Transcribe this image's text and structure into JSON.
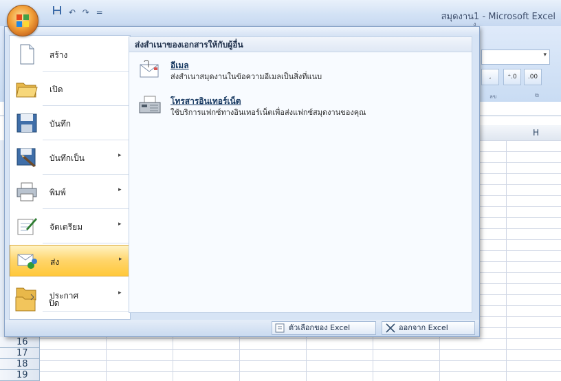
{
  "window": {
    "title": "สมุดงาน1 - Microsoft Excel"
  },
  "quick_access": {
    "save_icon": "save-icon",
    "undo": "↶",
    "redo": "↷",
    "customize": "="
  },
  "ribbon": {
    "tab_hint": "ง",
    "combo_arrow": "▾",
    "btn_increase": "+.0\n.00",
    "btn_decrease": ".00\n→.0",
    "group_label": "ลข",
    "comma": ","
  },
  "column_header_H": "H",
  "rows": [
    "16",
    "17",
    "18",
    "19"
  ],
  "menu": {
    "items": [
      {
        "label": "สร้าง",
        "icon": "new-document-icon",
        "arrow": ""
      },
      {
        "label": "เปิด",
        "icon": "open-folder-icon",
        "arrow": ""
      },
      {
        "label": "บันทึก",
        "icon": "save-icon",
        "arrow": ""
      },
      {
        "label": "บันทึกเป็น",
        "icon": "save-as-icon",
        "arrow": "▸"
      },
      {
        "label": "พิมพ์",
        "icon": "printer-icon",
        "arrow": "▸"
      },
      {
        "label": "จัดเตรียม",
        "icon": "prepare-icon",
        "arrow": "▸"
      },
      {
        "label": "ส่ง",
        "icon": "send-icon",
        "arrow": "▸"
      },
      {
        "label": "ประกาศ",
        "icon": "publish-icon",
        "arrow": "▸"
      },
      {
        "label": "ปิด",
        "icon": "close-folder-icon",
        "arrow": ""
      }
    ],
    "submenu_title": "ส่งสำเนาของเอกสารให้กับผู้อื่น",
    "submenu": [
      {
        "title": "อีเมล",
        "desc": "ส่งสำเนาสมุดงานในข้อความอีเมลเป็นสิ่งที่แนบ",
        "icon": "email-icon"
      },
      {
        "title": "โทรสารอินเทอร์เน็ต",
        "desc": "ใช้บริการแฟกซ์ทางอินเทอร์เน็ตเพื่อส่งแฟกซ์สมุดงานของคุณ",
        "icon": "fax-icon"
      }
    ],
    "options_button": "ตัวเลือกของ Excel",
    "exit_button": "ออกจาก Excel"
  }
}
